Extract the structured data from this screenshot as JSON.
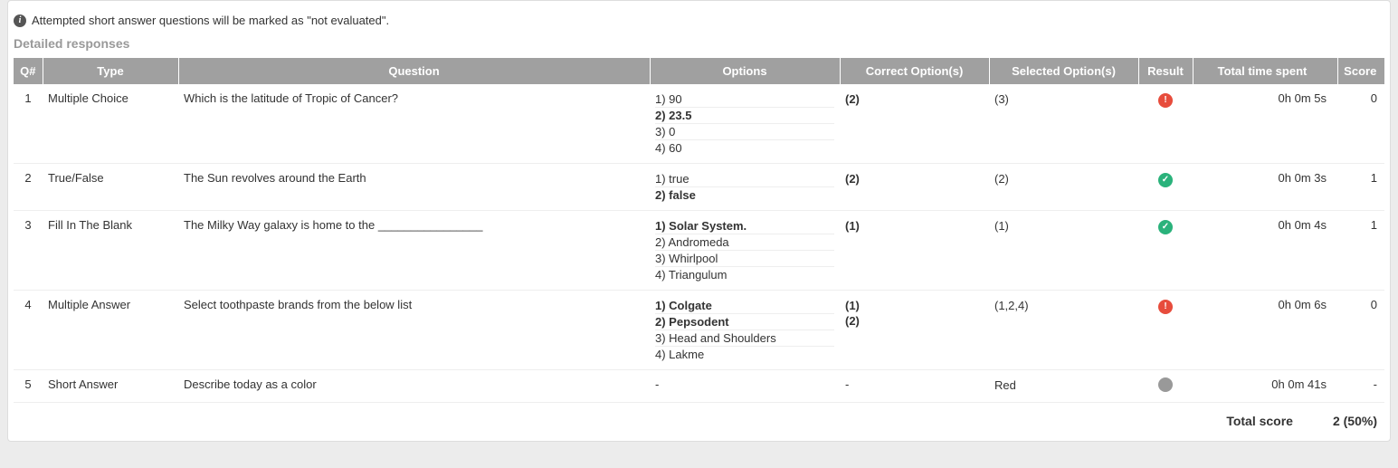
{
  "notice_text": "Attempted short answer questions will be marked as \"not evaluated\".",
  "section_title": "Detailed responses",
  "headers": {
    "qnum": "Q#",
    "type": "Type",
    "question": "Question",
    "options": "Options",
    "correct": "Correct Option(s)",
    "selected": "Selected Option(s)",
    "result": "Result",
    "time": "Total time spent",
    "score": "Score"
  },
  "rows": [
    {
      "qnum": "1",
      "type": "Multiple Choice",
      "question": "Which is the latitude of Tropic of Cancer?",
      "options": [
        {
          "label": "1) 90",
          "bold": false
        },
        {
          "label": "2) 23.5",
          "bold": true
        },
        {
          "label": "3) 0",
          "bold": false
        },
        {
          "label": "4) 60",
          "bold": false
        }
      ],
      "correct": [
        "(2)"
      ],
      "selected": [
        "(3)"
      ],
      "result": "incorrect",
      "time": "0h 0m 5s",
      "score": "0"
    },
    {
      "qnum": "2",
      "type": "True/False",
      "question": "The Sun revolves around the Earth",
      "options": [
        {
          "label": "1) true",
          "bold": false
        },
        {
          "label": "2) false",
          "bold": true
        }
      ],
      "correct": [
        "(2)"
      ],
      "selected": [
        "(2)"
      ],
      "result": "correct",
      "time": "0h 0m 3s",
      "score": "1"
    },
    {
      "qnum": "3",
      "type": "Fill In The Blank",
      "question": "The Milky Way galaxy is home to the ________________",
      "options": [
        {
          "label": "1) Solar System.",
          "bold": true
        },
        {
          "label": "2) Andromeda",
          "bold": false
        },
        {
          "label": "3) Whirlpool",
          "bold": false
        },
        {
          "label": "4) Triangulum",
          "bold": false
        }
      ],
      "correct": [
        "(1)"
      ],
      "selected": [
        "(1)"
      ],
      "result": "correct",
      "time": "0h 0m 4s",
      "score": "1"
    },
    {
      "qnum": "4",
      "type": "Multiple Answer",
      "question": "Select toothpaste brands from the below list",
      "options": [
        {
          "label": "1) Colgate",
          "bold": true
        },
        {
          "label": "2) Pepsodent",
          "bold": true
        },
        {
          "label": "3) Head and Shoulders",
          "bold": false
        },
        {
          "label": "4) Lakme",
          "bold": false
        }
      ],
      "correct": [
        "(1)",
        "(2)"
      ],
      "selected": [
        "(1,2,4)"
      ],
      "result": "incorrect",
      "time": "0h 0m 6s",
      "score": "0"
    },
    {
      "qnum": "5",
      "type": "Short Answer",
      "question": "Describe today as a color",
      "options_text": "-",
      "correct_text": "-",
      "selected": [
        "Red"
      ],
      "result": "pending",
      "time": "0h 0m 41s",
      "score": "-"
    }
  ],
  "footer": {
    "label": "Total score",
    "value": "2 (50%)"
  }
}
